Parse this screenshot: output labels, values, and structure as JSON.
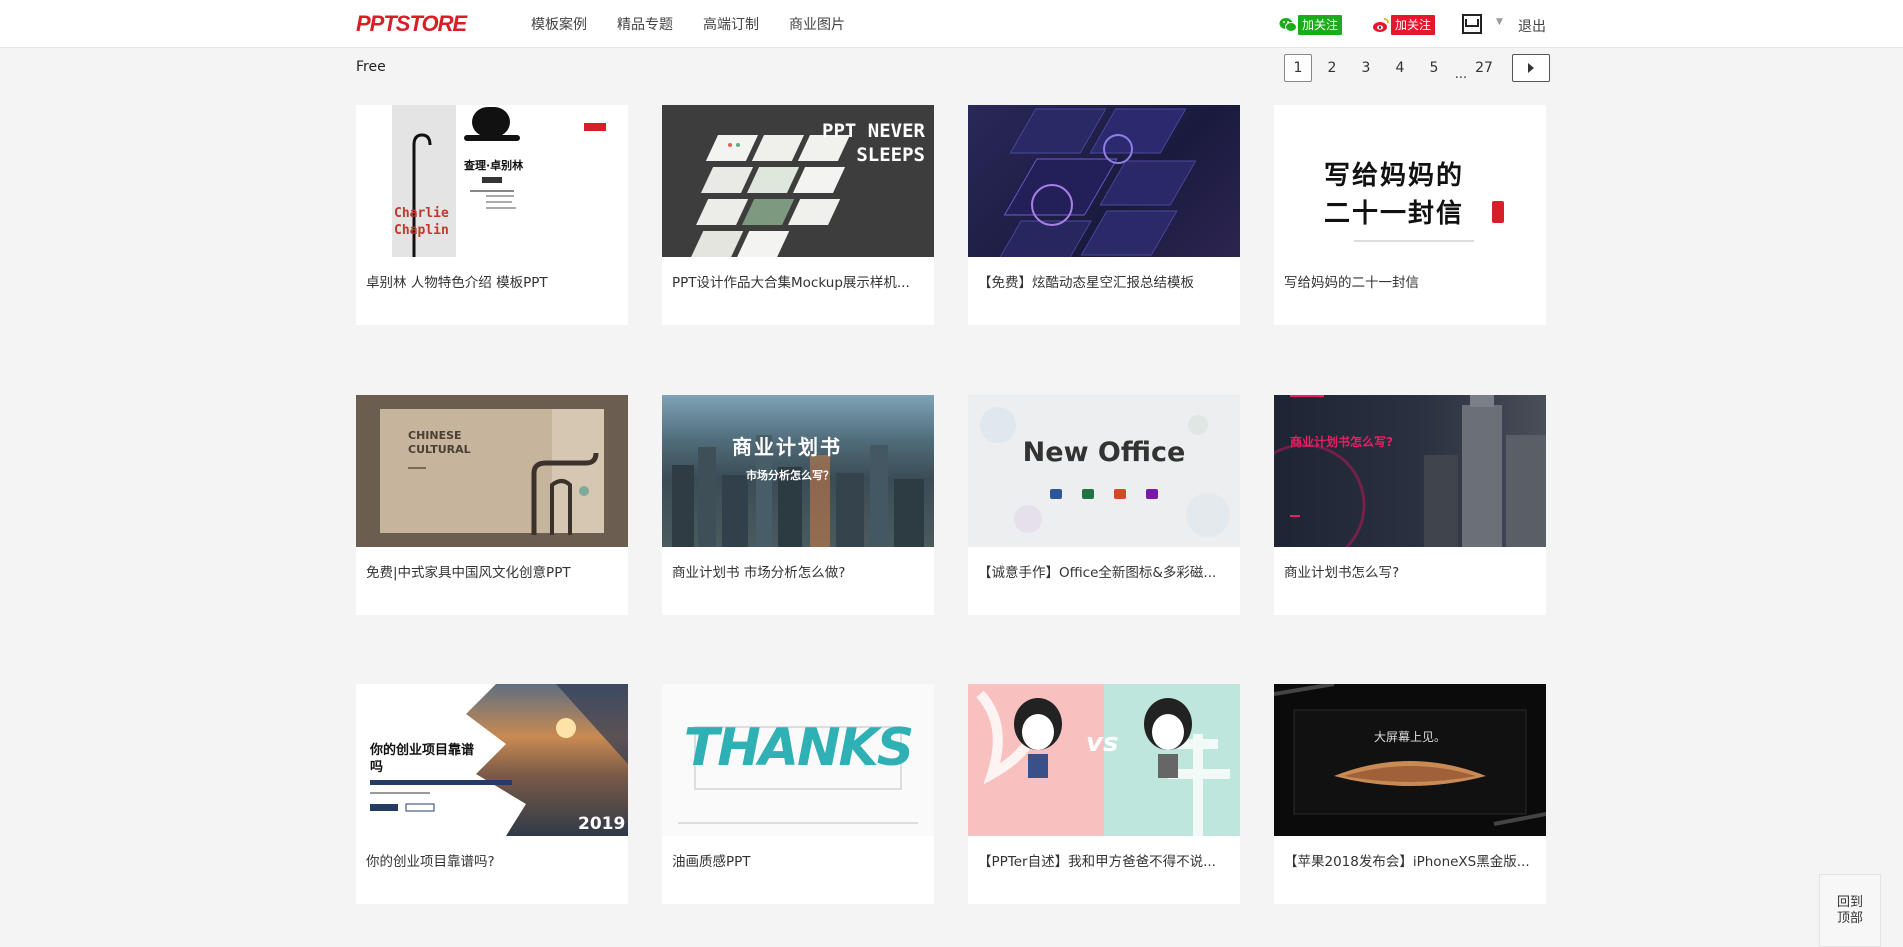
{
  "header": {
    "logo": "PPTSTORE",
    "nav": [
      "模板案例",
      "精品专题",
      "高端订制",
      "商业图片"
    ],
    "wechat_follow": "加关注",
    "weibo_follow": "加关注",
    "logout": "退出"
  },
  "filter": {
    "label": "Free"
  },
  "pagination": {
    "pages": [
      "1",
      "2",
      "3",
      "4",
      "5"
    ],
    "ellipsis": "...",
    "last": "27",
    "active": "1"
  },
  "cards": [
    {
      "title": "卓别林 人物特色介绍 模板PPT"
    },
    {
      "title": "PPT设计作品大合集Mockup展示样机..."
    },
    {
      "title": "【免费】炫酷动态星空汇报总结模板"
    },
    {
      "title": "写给妈妈的二十一封信"
    },
    {
      "title": "免费|中式家具中国风文化创意PPT"
    },
    {
      "title": "商业计划书 市场分析怎么做?"
    },
    {
      "title": "【诚意手作】Office全新图标&多彩磁..."
    },
    {
      "title": "商业计划书怎么写?"
    },
    {
      "title": "你的创业项目靠谱吗?"
    },
    {
      "title": "油画质感PPT"
    },
    {
      "title": "【PPTer自述】我和甲方爸爸不得不说..."
    },
    {
      "title": "【苹果2018发布会】iPhoneXS黑金版..."
    }
  ],
  "thumbs": {
    "chaplin_name": "Charlie Chaplin",
    "chaplin_cn": "查理·卓别林",
    "never_sleeps": "PPT NEVER SLEEPS",
    "letter_line1": "写给妈妈的",
    "letter_line2": "二十一封信",
    "chinese_cultural": "CHINESE CULTURAL",
    "biz_plan": "商业计划书",
    "biz_plan_sub": "市场分析怎么写？",
    "new_office": "New Office",
    "biz_plan2": "商业计划书怎么写?",
    "startup_q": "你的创业项目靠谱吗",
    "year": "2019",
    "thanks": "THANKS",
    "vs": "vs",
    "big_screen": "大屏幕上见。"
  },
  "back_to_top": {
    "line1": "回到",
    "line2": "顶部"
  },
  "colors": {
    "brand": "#d61f26",
    "wechat": "#1aad19",
    "weibo": "#e6162d",
    "background": "#f4f4f4"
  }
}
